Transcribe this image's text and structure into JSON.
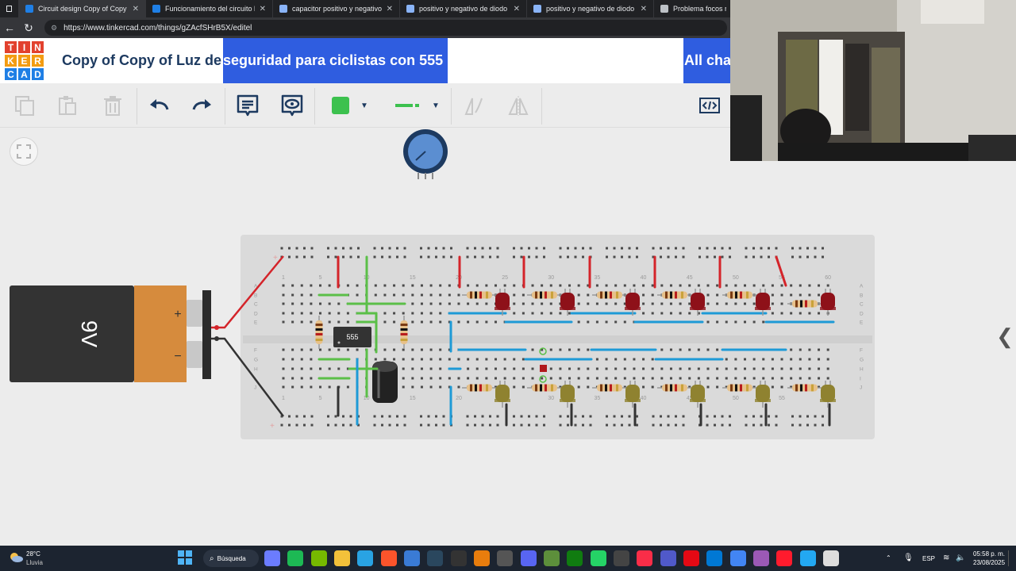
{
  "browser": {
    "tabs": [
      {
        "title": "Circuit design Copy of Copy of Lu",
        "active": true,
        "icon": "tinkercad-icon"
      },
      {
        "title": "Funcionamiento del circuito luz d",
        "active": false,
        "icon": "tinkercad-icon"
      },
      {
        "title": "capacitor positivo y negativo - Se",
        "active": false,
        "icon": "search-icon"
      },
      {
        "title": "positivo y negativo de diodo de F",
        "active": false,
        "icon": "search-icon"
      },
      {
        "title": "positivo y negativo de diodo de F",
        "active": false,
        "icon": "search-icon"
      },
      {
        "title": "Problema focos rojo",
        "active": false,
        "icon": "globe-icon"
      }
    ],
    "url": "https://www.tinkercad.com/things/gZAcfSHrB5X/editel"
  },
  "header": {
    "logo_letters": [
      "T",
      "I",
      "N",
      "K",
      "E",
      "R",
      "C",
      "A",
      "D"
    ],
    "title_part1": "Copy of Copy of Luz de",
    "title_part2": "seguridad para ciclistas con 555",
    "title_part3": "All cha"
  },
  "toolbar": {
    "color_swatch": "#3cc14e",
    "tools": [
      "copy-icon",
      "paste-icon",
      "delete-icon",
      "undo-icon",
      "redo-icon",
      "notes-icon",
      "view-icon",
      "color-picker",
      "wire-style",
      "rotate-icon",
      "mirror-icon",
      "code-icon"
    ]
  },
  "canvas": {
    "battery_label": "9V",
    "battery_plus": "+",
    "battery_minus": "−",
    "ic_label": "555",
    "column_numbers": [
      "1",
      "5",
      "10",
      "15",
      "20",
      "25",
      "30",
      "35",
      "40",
      "45",
      "50",
      "55",
      "60"
    ],
    "row_letters_top": [
      "A",
      "B",
      "C",
      "D",
      "E"
    ],
    "row_letters_bottom": [
      "F",
      "G",
      "H",
      "I",
      "J"
    ]
  },
  "taskbar": {
    "weather_temp": "28°C",
    "weather_desc": "Lluvia",
    "search_label": "Búsqueda",
    "language": "ESP",
    "time": "05:58 p. m.",
    "date": "23/08/2025"
  }
}
